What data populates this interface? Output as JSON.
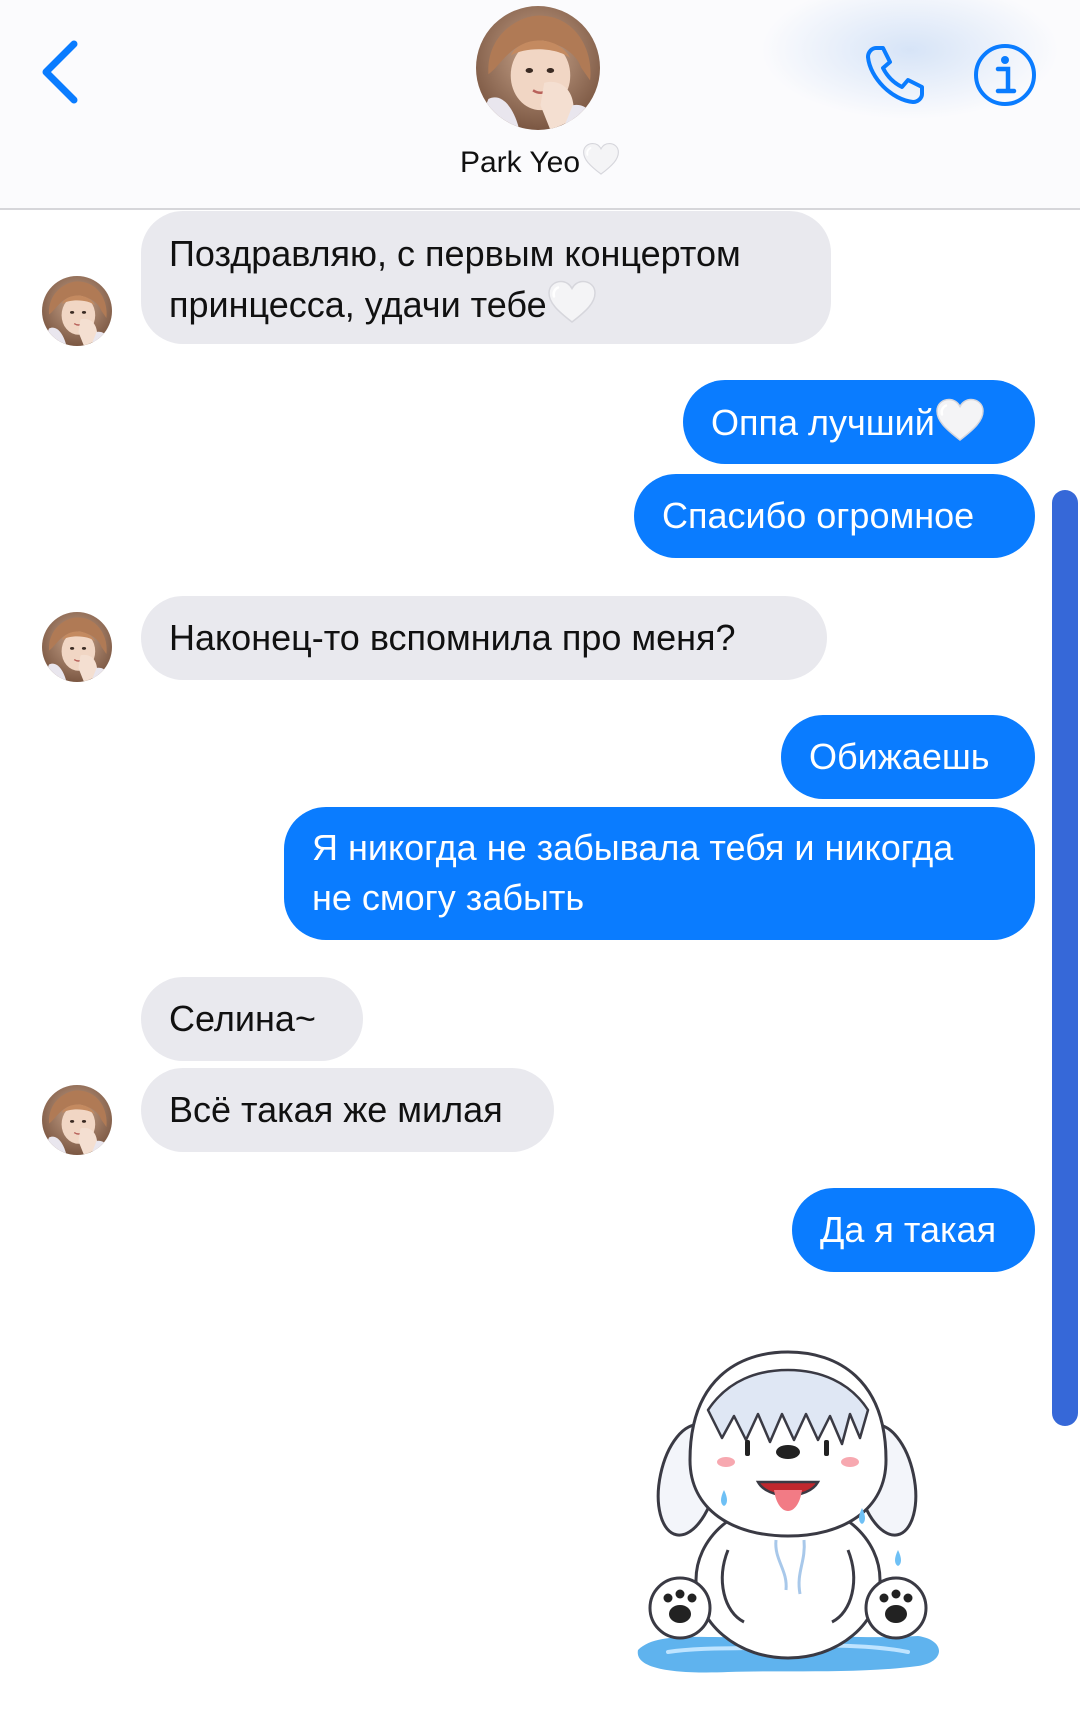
{
  "header": {
    "contact_name": "Park Yeo",
    "back_icon": "chevron-left-icon",
    "call_icon": "phone-icon",
    "info_icon": "info-icon",
    "accent_color": "#0a7cff"
  },
  "messages": [
    {
      "direction": "incoming",
      "lines": [
        "Поздравляю, с первым концертом",
        "принцесса, удачи тебе"
      ],
      "emoji": "white-heart"
    },
    {
      "direction": "outgoing",
      "text": "Оппа лучший",
      "emoji": "white-heart"
    },
    {
      "direction": "outgoing",
      "text": "Спасибо огромное"
    },
    {
      "direction": "incoming",
      "text": "Наконец-то вспомнила про меня?"
    },
    {
      "direction": "outgoing",
      "text": "Обижаешь"
    },
    {
      "direction": "outgoing",
      "lines": [
        "Я никогда не забывала тебя и никогда",
        "не смогу забыть"
      ]
    },
    {
      "direction": "incoming",
      "text": "Селина~"
    },
    {
      "direction": "incoming",
      "text": "Всё такая же милая"
    },
    {
      "direction": "outgoing",
      "text": "Да я такая"
    }
  ],
  "sticker": {
    "name": "wet-polar-bear-sticker"
  },
  "colors": {
    "incoming_bubble": "#e9e9ee",
    "outgoing_bubble": "#0a7cff",
    "scroll_indicator": "#3668d8"
  }
}
